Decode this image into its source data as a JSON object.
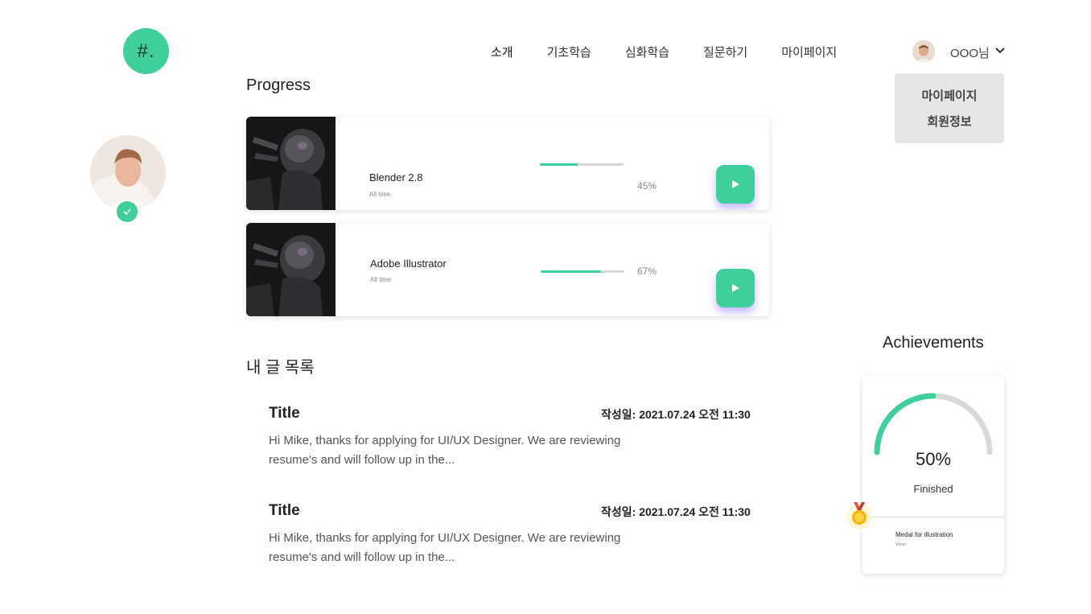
{
  "logo": {
    "text": "#."
  },
  "nav": {
    "items": [
      "소개",
      "기초학습",
      "심화학습",
      "질문하기",
      "마이페이지"
    ]
  },
  "user": {
    "name": "OOO님",
    "menu": [
      "마이페이지",
      "회원정보"
    ]
  },
  "progress": {
    "title": "Progress",
    "courses": [
      {
        "name": "Blender 2.8",
        "sub": "All time",
        "percent_label": "45%",
        "percent": 45
      },
      {
        "name": "Adobe Illustrator",
        "sub": "All time",
        "percent_label": "67%",
        "percent": 67
      }
    ]
  },
  "posts": {
    "title": "내 글 목록",
    "items": [
      {
        "title": "Title",
        "date": "작성일: 2021.07.24 오전 11:30",
        "body": " Hi Mike, thanks for applying for UI/UX Designer. We are reviewing resume's and will follow up in the..."
      },
      {
        "title": "Title",
        "date": "작성일: 2021.07.24 오전 11:30",
        "body": " Hi Mike, thanks for applying for UI/UX Designer. We are reviewing resume's and will follow up in the..."
      }
    ]
  },
  "achievements": {
    "title": "Achievements",
    "percent_label": "50%",
    "percent": 50,
    "status": "Finished",
    "medal_name": "Medal for illustration",
    "medal_sub": "Winer"
  },
  "colors": {
    "accent": "#3ecf9a",
    "dropdown_bg": "#e6e6e6",
    "play_shadow": "#7b61ff"
  }
}
